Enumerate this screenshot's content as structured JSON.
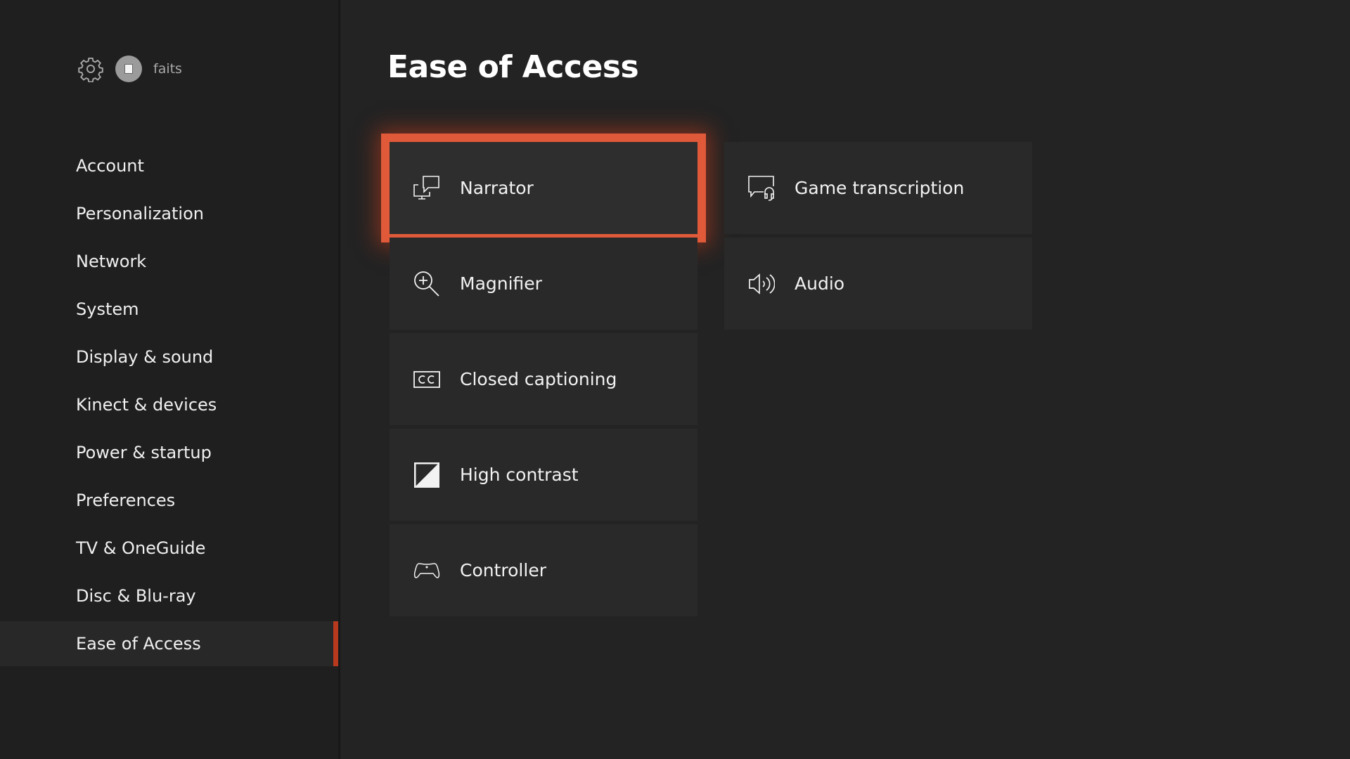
{
  "colors": {
    "accent": "#b83a1e",
    "focus": "#e05a3a",
    "background": "#232323",
    "sidebar": "#1f1f1f",
    "tile": "#292929"
  },
  "profile": {
    "gamertag": "faits",
    "settings_icon": "gear-icon",
    "avatar_icon": "avatar-icon"
  },
  "sidebar": {
    "items": [
      {
        "label": "Account",
        "selected": false
      },
      {
        "label": "Personalization",
        "selected": false
      },
      {
        "label": "Network",
        "selected": false
      },
      {
        "label": "System",
        "selected": false
      },
      {
        "label": "Display & sound",
        "selected": false
      },
      {
        "label": "Kinect & devices",
        "selected": false
      },
      {
        "label": "Power & startup",
        "selected": false
      },
      {
        "label": "Preferences",
        "selected": false
      },
      {
        "label": "TV & OneGuide",
        "selected": false
      },
      {
        "label": "Disc & Blu-ray",
        "selected": false
      },
      {
        "label": "Ease of Access",
        "selected": true
      }
    ]
  },
  "main": {
    "title": "Ease of Access",
    "tiles": [
      {
        "label": "Narrator",
        "icon": "narrator-icon",
        "focused": true
      },
      {
        "label": "Magnifier",
        "icon": "magnifier-icon",
        "focused": false
      },
      {
        "label": "Closed captioning",
        "icon": "closed-captioning-icon",
        "focused": false
      },
      {
        "label": "High contrast",
        "icon": "high-contrast-icon",
        "focused": false
      },
      {
        "label": "Controller",
        "icon": "controller-icon",
        "focused": false
      },
      {
        "label": "Game transcription",
        "icon": "game-transcription-icon",
        "focused": false
      },
      {
        "label": "Audio",
        "icon": "audio-icon",
        "focused": false
      }
    ]
  }
}
